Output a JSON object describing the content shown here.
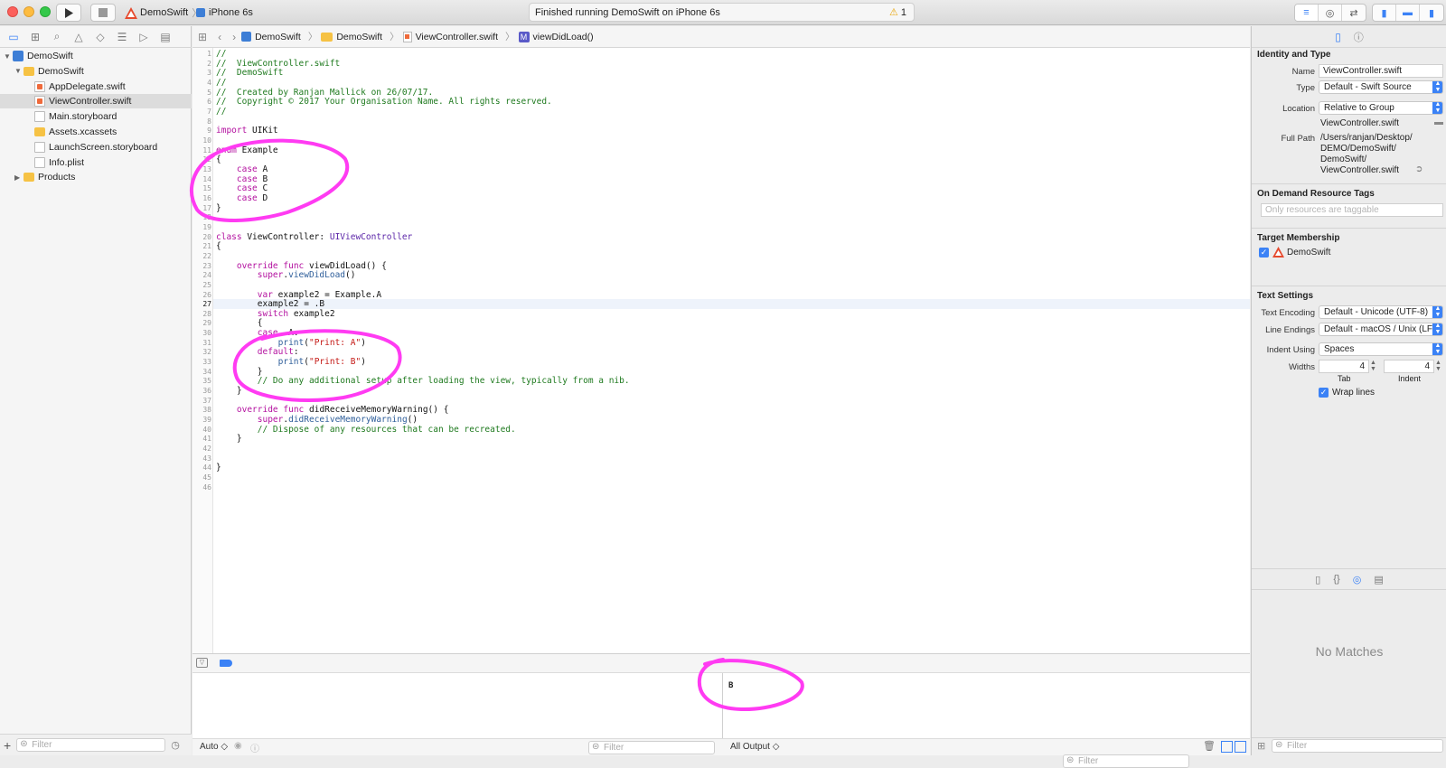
{
  "toolbar": {
    "scheme_name": "DemoSwift",
    "device_name": "iPhone 6s",
    "status_text": "Finished running DemoSwift on iPhone 6s",
    "warning_count": "1"
  },
  "navigator": {
    "items": [
      {
        "label": "DemoSwift",
        "kind": "project",
        "depth": 0,
        "disclosure": "open"
      },
      {
        "label": "DemoSwift",
        "kind": "folder",
        "depth": 1,
        "disclosure": "open"
      },
      {
        "label": "AppDelegate.swift",
        "kind": "swift",
        "depth": 2
      },
      {
        "label": "ViewController.swift",
        "kind": "swift",
        "depth": 2,
        "selected": true
      },
      {
        "label": "Main.storyboard",
        "kind": "doc",
        "depth": 2
      },
      {
        "label": "Assets.xcassets",
        "kind": "folder",
        "depth": 2
      },
      {
        "label": "LaunchScreen.storyboard",
        "kind": "doc",
        "depth": 2
      },
      {
        "label": "Info.plist",
        "kind": "doc",
        "depth": 2
      },
      {
        "label": "Products",
        "kind": "folder",
        "depth": 1,
        "disclosure": "closed"
      }
    ],
    "filter_placeholder": "Filter"
  },
  "jumpbar": {
    "crumbs": [
      "DemoSwift",
      "DemoSwift",
      "ViewController.swift",
      "viewDidLoad()"
    ],
    "method_badge": "M"
  },
  "editor": {
    "current_line": 27,
    "lines": [
      [
        {
          "t": "//",
          "c": "cm"
        }
      ],
      [
        {
          "t": "//  ViewController.swift",
          "c": "cm"
        }
      ],
      [
        {
          "t": "//  DemoSwift",
          "c": "cm"
        }
      ],
      [
        {
          "t": "//",
          "c": "cm"
        }
      ],
      [
        {
          "t": "//  Created by Ranjan Mallick on 26/07/17.",
          "c": "cm"
        }
      ],
      [
        {
          "t": "//  Copyright © 2017 Your Organisation Name. All rights reserved.",
          "c": "cm"
        }
      ],
      [
        {
          "t": "//",
          "c": "cm"
        }
      ],
      [],
      [
        {
          "t": "import",
          "c": "kw"
        },
        {
          "t": " UIKit"
        }
      ],
      [],
      [
        {
          "t": "enum",
          "c": "kw"
        },
        {
          "t": " Example"
        }
      ],
      [
        {
          "t": "{"
        }
      ],
      [
        {
          "t": "    "
        },
        {
          "t": "case",
          "c": "kw"
        },
        {
          "t": " A"
        }
      ],
      [
        {
          "t": "    "
        },
        {
          "t": "case",
          "c": "kw"
        },
        {
          "t": " B"
        }
      ],
      [
        {
          "t": "    "
        },
        {
          "t": "case",
          "c": "kw"
        },
        {
          "t": " C"
        }
      ],
      [
        {
          "t": "    "
        },
        {
          "t": "case",
          "c": "kw"
        },
        {
          "t": " D"
        }
      ],
      [
        {
          "t": "}"
        }
      ],
      [],
      [],
      [
        {
          "t": "class",
          "c": "kw"
        },
        {
          "t": " ViewController: "
        },
        {
          "t": "UIViewController",
          "c": "ty"
        }
      ],
      [
        {
          "t": "{"
        }
      ],
      [],
      [
        {
          "t": "    "
        },
        {
          "t": "override",
          "c": "kw"
        },
        {
          "t": " "
        },
        {
          "t": "func",
          "c": "kw"
        },
        {
          "t": " viewDidLoad() {"
        }
      ],
      [
        {
          "t": "        "
        },
        {
          "t": "super",
          "c": "kw"
        },
        {
          "t": "."
        },
        {
          "t": "viewDidLoad",
          "c": "fn"
        },
        {
          "t": "()"
        }
      ],
      [],
      [
        {
          "t": "        "
        },
        {
          "t": "var",
          "c": "kw"
        },
        {
          "t": " example2 = Example.A"
        }
      ],
      [
        {
          "t": "        example2 = .B"
        }
      ],
      [
        {
          "t": "        "
        },
        {
          "t": "switch",
          "c": "kw"
        },
        {
          "t": " example2"
        }
      ],
      [
        {
          "t": "        {"
        }
      ],
      [
        {
          "t": "        "
        },
        {
          "t": "case",
          "c": "kw"
        },
        {
          "t": " .A:"
        }
      ],
      [
        {
          "t": "            "
        },
        {
          "t": "print",
          "c": "fn"
        },
        {
          "t": "("
        },
        {
          "t": "\"Print: A\"",
          "c": "st"
        },
        {
          "t": ")"
        }
      ],
      [
        {
          "t": "        "
        },
        {
          "t": "default",
          "c": "kw"
        },
        {
          "t": ":"
        }
      ],
      [
        {
          "t": "            "
        },
        {
          "t": "print",
          "c": "fn"
        },
        {
          "t": "("
        },
        {
          "t": "\"Print: B\"",
          "c": "st"
        },
        {
          "t": ")"
        }
      ],
      [
        {
          "t": "        }"
        }
      ],
      [
        {
          "t": "        "
        },
        {
          "t": "// Do any additional setup after loading the view, typically from a nib.",
          "c": "cm"
        }
      ],
      [
        {
          "t": "    }"
        }
      ],
      [],
      [
        {
          "t": "    "
        },
        {
          "t": "override",
          "c": "kw"
        },
        {
          "t": " "
        },
        {
          "t": "func",
          "c": "kw"
        },
        {
          "t": " didReceiveMemoryWarning() {"
        }
      ],
      [
        {
          "t": "        "
        },
        {
          "t": "super",
          "c": "kw"
        },
        {
          "t": "."
        },
        {
          "t": "didReceiveMemoryWarning",
          "c": "fn"
        },
        {
          "t": "()"
        }
      ],
      [
        {
          "t": "        "
        },
        {
          "t": "// Dispose of any resources that can be recreated.",
          "c": "cm"
        }
      ],
      [
        {
          "t": "    }"
        }
      ],
      [],
      [],
      [
        {
          "t": "}"
        }
      ],
      [],
      []
    ]
  },
  "debug": {
    "console_output": "B",
    "auto_label": "Auto ◇",
    "output_label": "All Output ◇",
    "filter_placeholder": "Filter"
  },
  "inspector": {
    "identity_title": "Identity and Type",
    "name_label": "Name",
    "name_value": "ViewController.swift",
    "type_label": "Type",
    "type_value": "Default - Swift Source",
    "location_label": "Location",
    "location_value": "Relative to Group",
    "location_file": "ViewController.swift",
    "fullpath_label": "Full Path",
    "fullpath_lines": [
      "/Users/ranjan/Desktop/",
      "DEMO/DemoSwift/",
      "DemoSwift/",
      "ViewController.swift"
    ],
    "odr_title": "On Demand Resource Tags",
    "odr_placeholder": "Only resources are taggable",
    "target_title": "Target Membership",
    "target_name": "DemoSwift",
    "text_settings_title": "Text Settings",
    "encoding_label": "Text Encoding",
    "encoding_value": "Default - Unicode (UTF-8)",
    "line_endings_label": "Line Endings",
    "line_endings_value": "Default - macOS / Unix (LF)",
    "indent_using_label": "Indent Using",
    "indent_using_value": "Spaces",
    "widths_label": "Widths",
    "tab_value": "4",
    "indent_value": "4",
    "tab_caption": "Tab",
    "indent_caption": "Indent",
    "wrap_lines_label": "Wrap lines",
    "no_matches": "No Matches",
    "filter_placeholder": "Filter"
  },
  "colors": {
    "annotation": "#ff3bf2",
    "accent": "#3b82f6"
  }
}
